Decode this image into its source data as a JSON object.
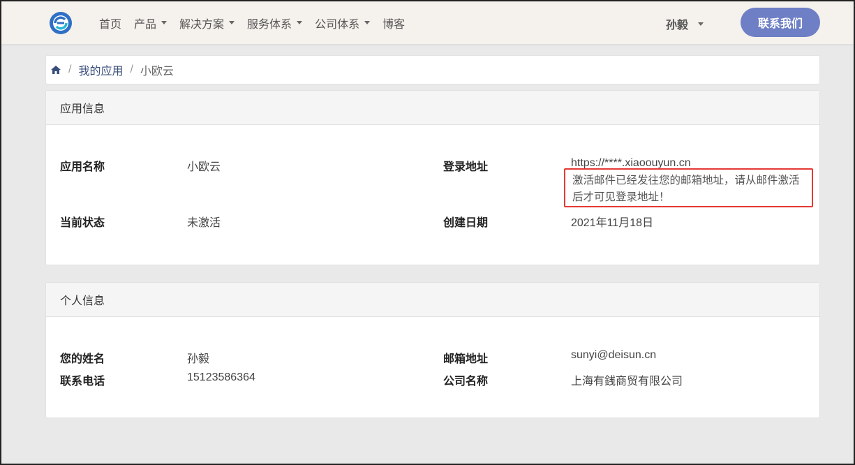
{
  "nav": {
    "items": [
      {
        "label": "首页",
        "dropdown": false
      },
      {
        "label": "产品",
        "dropdown": true
      },
      {
        "label": "解决方案",
        "dropdown": true
      },
      {
        "label": "服务体系",
        "dropdown": true
      },
      {
        "label": "公司体系",
        "dropdown": true
      },
      {
        "label": "博客",
        "dropdown": false
      }
    ],
    "user_name": "孙毅",
    "contact_label": "联系我们"
  },
  "breadcrumb": {
    "my_apps": "我的应用",
    "current": "小欧云",
    "separator": "/"
  },
  "app_info": {
    "header": "应用信息",
    "name_label": "应用名称",
    "name_value": "小欧云",
    "status_label": "当前状态",
    "status_value": "未激活",
    "login_label": "登录地址",
    "login_value": "https://****.xiaoouyun.cn",
    "notice": "激活邮件已经发往您的邮箱地址，请从邮件激活后才可见登录地址！",
    "created_label": "创建日期",
    "created_value": "2021年11月18日"
  },
  "personal_info": {
    "header": "个人信息",
    "name_label": "您的姓名",
    "name_value": "孙毅",
    "phone_label": "联系电话",
    "phone_value": "15123586364",
    "email_label": "邮箱地址",
    "email_value": "sunyi@deisun.cn",
    "company_label": "公司名称",
    "company_value": "上海有銭商贸有限公司"
  },
  "colors": {
    "accent": "#6e7fc6",
    "notice_border": "#e53935",
    "navbar_bg": "#f5f1ec"
  }
}
